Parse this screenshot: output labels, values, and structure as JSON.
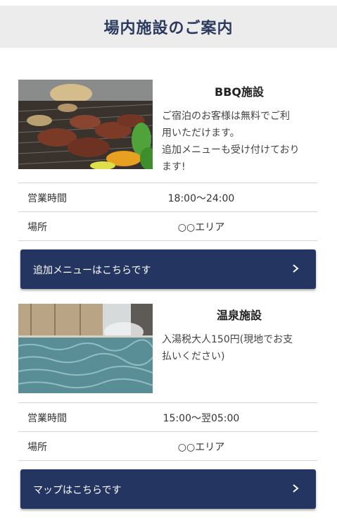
{
  "page": {
    "title": "場内施設のご案内"
  },
  "facilities": [
    {
      "name": "BBQ施設",
      "desc_lines": [
        "ご宿泊のお客様は無料でご利",
        "用いただけます。",
        "追加メニューも受け付けており",
        "ます!"
      ],
      "rows": [
        {
          "key": "営業時間",
          "value": "18:00〜24:00"
        },
        {
          "key": "場所",
          "value": "○○エリア"
        }
      ],
      "button_label": "追加メニューはこちらです",
      "image_icon": "bbq-photo"
    },
    {
      "name": "温泉施設",
      "desc_lines": [
        "入湯税大人150円(現地でお支",
        "払いください)"
      ],
      "rows": [
        {
          "key": "営業時間",
          "value": "15:00〜翌05:00"
        },
        {
          "key": "場所",
          "value": "○○エリア"
        }
      ],
      "button_label": "マップはこちらです",
      "image_icon": "hot-spring-photo"
    }
  ],
  "colors": {
    "header_bg": "#ececec",
    "title": "#2b3a5e",
    "button_bg": "#253561",
    "divider": "#d7d7d7"
  },
  "icons": {
    "button_arrow": "chevron-right-icon"
  }
}
